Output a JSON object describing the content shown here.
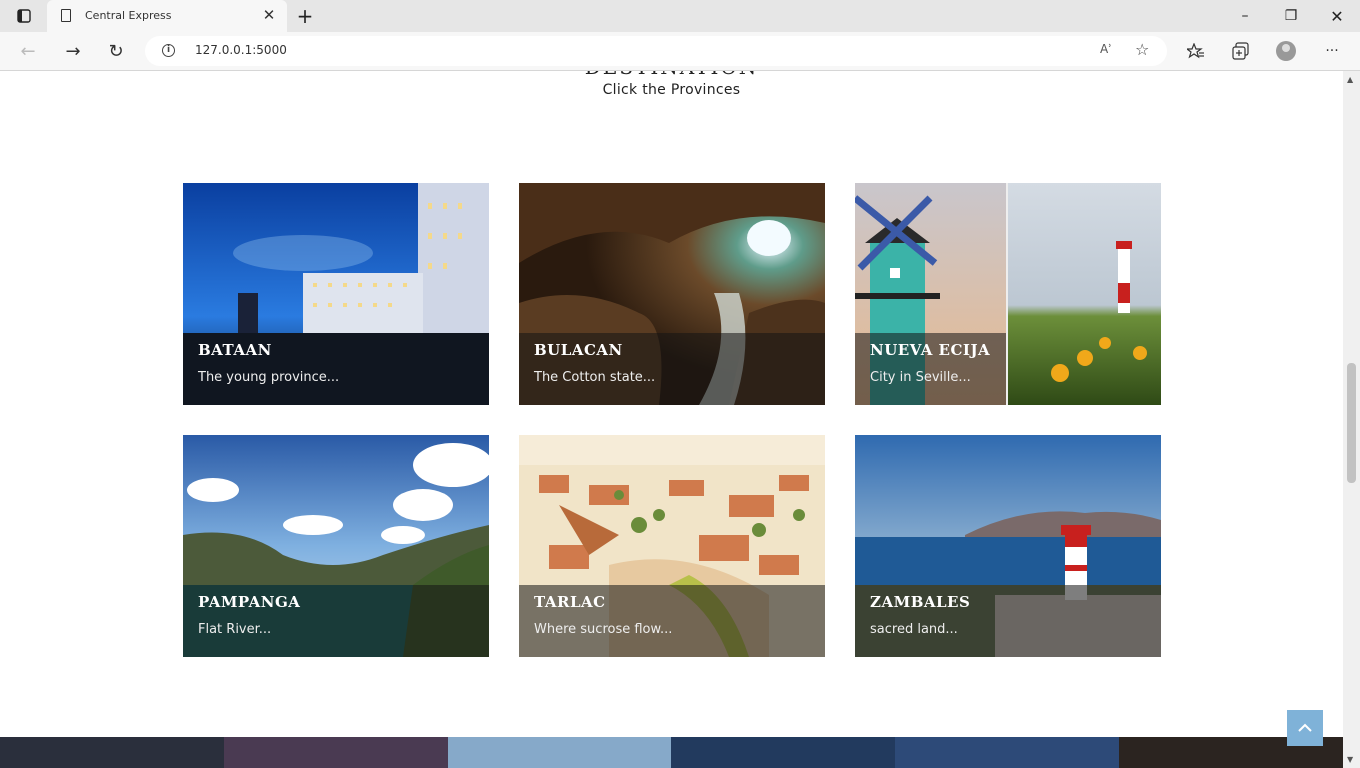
{
  "browser": {
    "tab_title": "Central Express",
    "url": "127.0.0.1:5000",
    "read_aloud_label": "Aʾ"
  },
  "page": {
    "heading": "DESTINATION",
    "subheading": "Click the Provinces"
  },
  "provinces": [
    {
      "name": "BATAAN",
      "desc": "The young province..."
    },
    {
      "name": "BULACAN",
      "desc": "The Cotton state..."
    },
    {
      "name": "NUEVA ECIJA",
      "desc": "City in Seville..."
    },
    {
      "name": "PAMPANGA",
      "desc": "Flat River..."
    },
    {
      "name": "TARLAC",
      "desc": "Where sucrose flow..."
    },
    {
      "name": "ZAMBALES",
      "desc": "sacred land..."
    }
  ],
  "colors": {
    "back_to_top": "#7fb2d8"
  }
}
